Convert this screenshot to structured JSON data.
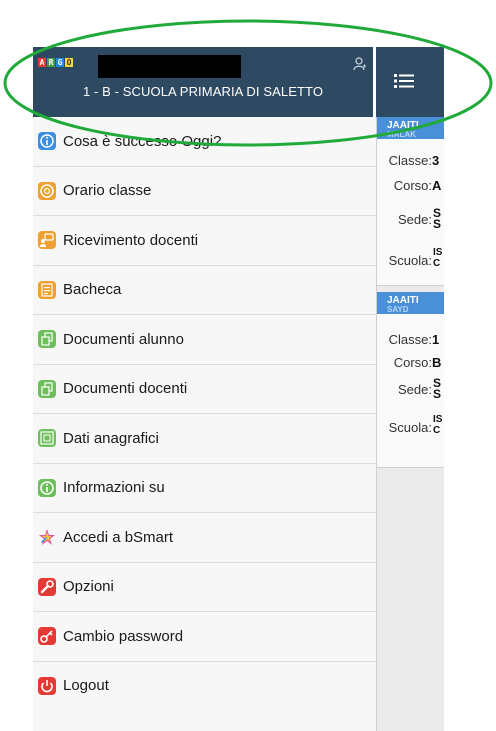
{
  "header": {
    "logo_letters": [
      "A",
      "R",
      "G",
      "O"
    ],
    "logo_colors": [
      "#e53935",
      "#43a047",
      "#1e88e5",
      "#fdd835"
    ],
    "class_title": "1 - B - SCUOLA PRIMARIA DI SALETTO"
  },
  "menu": {
    "items": [
      {
        "label": "Cosa è successo Oggi?",
        "icon": "info-icon",
        "color": "#3b8fe0"
      },
      {
        "label": "Orario classe",
        "icon": "clock-icon",
        "color": "#f0a030"
      },
      {
        "label": "Ricevimento docenti",
        "icon": "chat-icon",
        "color": "#f0a030"
      },
      {
        "label": "Bacheca",
        "icon": "board-icon",
        "color": "#f0a030"
      },
      {
        "label": "Documenti alunno",
        "icon": "documents-icon",
        "color": "#6cbf5a"
      },
      {
        "label": "Documenti docenti",
        "icon": "documents-icon",
        "color": "#6cbf5a"
      },
      {
        "label": "Dati anagrafici",
        "icon": "id-card-icon",
        "color": "#6cbf5a"
      },
      {
        "label": "Informazioni su",
        "icon": "info-icon",
        "color": "#6cbf5a"
      },
      {
        "label": "Accedi a bSmart",
        "icon": "bsmart-icon",
        "color": "#e0529c"
      },
      {
        "label": "Opzioni",
        "icon": "wrench-icon",
        "color": "#e53935"
      },
      {
        "label": "Cambio password",
        "icon": "key-icon",
        "color": "#e53935"
      },
      {
        "label": "Logout",
        "icon": "power-icon",
        "color": "#e53935"
      }
    ]
  },
  "cards": [
    {
      "name": "JAAITI",
      "sub": "MALAK",
      "classe_label": "Classe:",
      "classe_val": "3",
      "corso_label": "Corso:",
      "corso_val": "A",
      "sede_label": "Sede:",
      "sede_val": "S S",
      "scuola_label": "Scuola:",
      "scuola_val": "IS C"
    },
    {
      "name": "JAAITI",
      "sub": "SAYD",
      "classe_label": "Classe:",
      "classe_val": "1",
      "corso_label": "Corso:",
      "corso_val": "B",
      "sede_label": "Sede:",
      "sede_val": "S S",
      "scuola_label": "Scuola:",
      "scuola_val": "IS C"
    }
  ],
  "colors": {
    "header_bg": "#2e4a63",
    "annotation": "#1faa3a"
  }
}
